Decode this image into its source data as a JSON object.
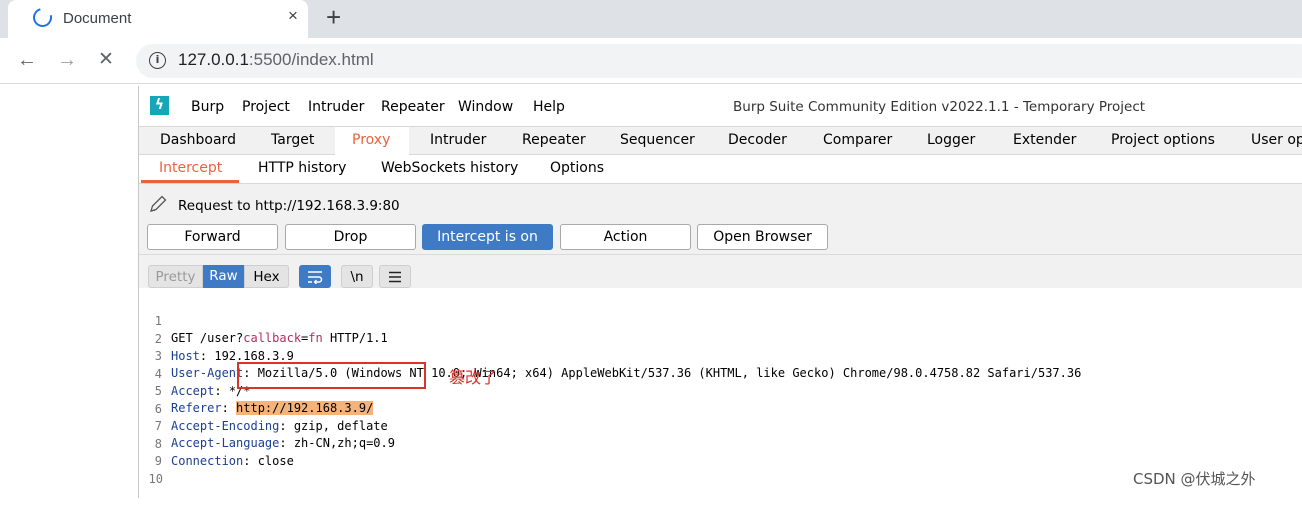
{
  "browser": {
    "tab_title": "Document",
    "tab_close": "×",
    "new_tab": "+",
    "back": "←",
    "forward": "→",
    "stop": "✕",
    "url_host": "127.0.0.1",
    "url_rest": ":5500/index.html"
  },
  "burp": {
    "logo": "ϟ",
    "menu": [
      "Burp",
      "Project",
      "Intruder",
      "Repeater",
      "Window",
      "Help"
    ],
    "window_title": "Burp Suite Community Edition v2022.1.1 - Temporary Project",
    "main_tabs": [
      "Dashboard",
      "Target",
      "Proxy",
      "Intruder",
      "Repeater",
      "Sequencer",
      "Decoder",
      "Comparer",
      "Logger",
      "Extender",
      "Project options",
      "User opt"
    ],
    "active_main_tab": "Proxy",
    "sub_tabs": [
      "Intercept",
      "HTTP history",
      "WebSockets history",
      "Options"
    ],
    "active_sub_tab": "Intercept",
    "request_label": "Request to http://192.168.3.9:80",
    "buttons": {
      "forward": "Forward",
      "drop": "Drop",
      "intercept": "Intercept is on",
      "action": "Action",
      "open_browser": "Open Browser"
    },
    "view_modes": {
      "pretty": "Pretty",
      "raw": "Raw",
      "hex": "Hex",
      "newline": "\\n"
    },
    "request_lines": [
      {
        "num": "1",
        "text": "GET /user?callback=fn HTTP/1.1"
      },
      {
        "num": "2",
        "key": "Host",
        "value": " 192.168.3.9"
      },
      {
        "num": "3",
        "key": "User-Agent",
        "value": " Mozilla/5.0 (Windows NT 10.0; Win64; x64) AppleWebKit/537.36 (KHTML, like Gecko) Chrome/98.0.4758.82 Safari/537.36"
      },
      {
        "num": "4",
        "key": "Accept",
        "value": " */*"
      },
      {
        "num": "5",
        "key": "Referer",
        "value": "http://192.168.3.9/"
      },
      {
        "num": "6",
        "key": "Accept-Encoding",
        "value": " gzip, deflate"
      },
      {
        "num": "7",
        "key": "Accept-Language",
        "value": " zh-CN,zh;q=0.9"
      },
      {
        "num": "8",
        "key": "Connection",
        "value": " close"
      },
      {
        "num": "9",
        "text": ""
      },
      {
        "num": "10",
        "text": ""
      }
    ],
    "request_parts": {
      "method": "GET /user?",
      "param_name": "callback",
      "eq": "=",
      "param_value": "fn",
      "protocol": " HTTP/1.1"
    }
  },
  "annotation": "篡改了",
  "watermark": "CSDN @伏城之外",
  "colors": {
    "accent_orange": "#e8643c",
    "burp_blue": "#3f7bc4",
    "annotation_red": "#d9342b",
    "highlight": "#f5b37a"
  }
}
